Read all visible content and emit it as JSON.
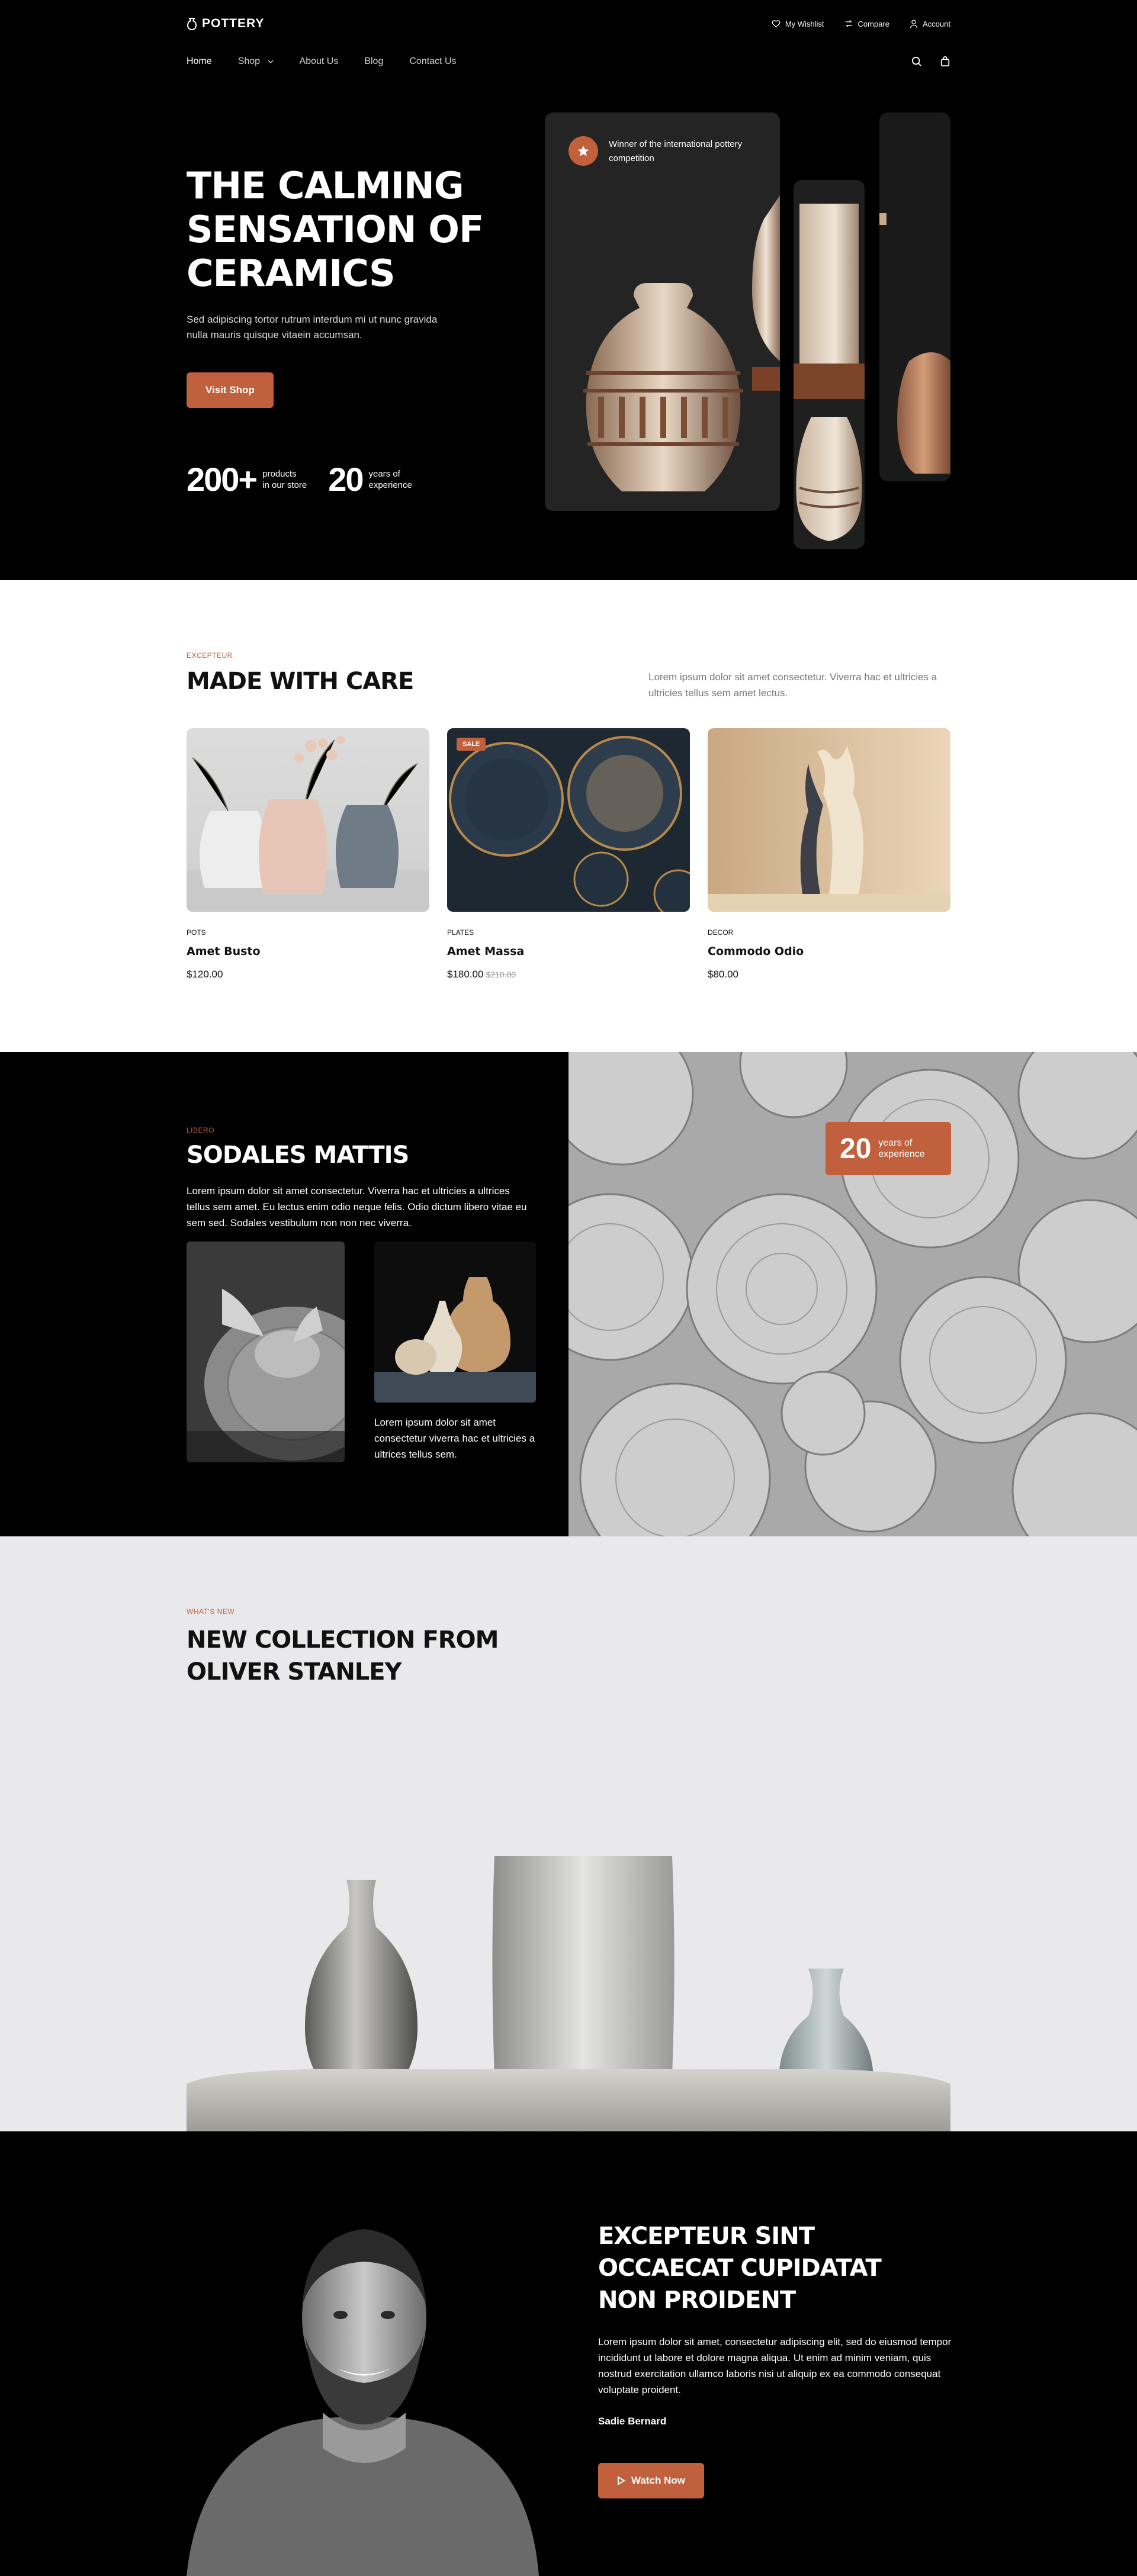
{
  "header": {
    "logo": "POTTERY",
    "utils": [
      {
        "label": "My Wishlist",
        "icon": "heart-icon"
      },
      {
        "label": "Compare",
        "icon": "compare-icon"
      },
      {
        "label": "Account",
        "icon": "user-icon"
      }
    ],
    "nav": [
      {
        "label": "Home",
        "active": true
      },
      {
        "label": "Shop",
        "active": false,
        "has_dropdown": true
      },
      {
        "label": "About Us",
        "active": false
      },
      {
        "label": "Blog",
        "active": false
      },
      {
        "label": "Contact Us",
        "active": false
      }
    ]
  },
  "hero": {
    "title_lines": [
      "THE CALMING",
      "SENSATION OF",
      "CERAMICS"
    ],
    "text": "Sed adipiscing tortor rutrum interdum mi ut nunc gravida nulla mauris quisque vitaein accumsan.",
    "button": "Visit Shop",
    "stats": [
      {
        "num": "200+",
        "label_1": "products",
        "label_2": "in our store"
      },
      {
        "num": "20",
        "label_1": "years of",
        "label_2": "experience"
      }
    ],
    "award": "Winner of the international pottery competition"
  },
  "care": {
    "eyebrow": "EXCEPTEUR",
    "title": "MADE WITH CARE",
    "desc": "Lorem ipsum dolor sit amet consectetur. Viverra hac et ultricies a ultricies tellus sem amet lectus.",
    "products": [
      {
        "category": "POTS",
        "name": "Amet Busto",
        "price": "$120.00",
        "old_price": "",
        "sale": ""
      },
      {
        "category": "PLATES",
        "name": "Amet Massa",
        "price": "$180.00",
        "old_price": "$210.00",
        "sale": "SALE"
      },
      {
        "category": "DECOR",
        "name": "Commodo Odio",
        "price": "$80.00",
        "old_price": "",
        "sale": ""
      }
    ]
  },
  "sodales": {
    "eyebrow": "LIBERO",
    "title": "SODALES MATTIS",
    "text": "Lorem ipsum dolor sit amet consectetur. Viverra hac et ultricies a ultrices tellus sem amet. Eu lectus enim odio neque felis. Odio dictum libero vitae eu sem sed. Sodales vestibulum non non nec viverra.",
    "caption": "Lorem ipsum dolor sit amet consectetur viverra hac et ultricies a ultrices tellus sem.",
    "badge": {
      "num": "20",
      "label_1": "years of",
      "label_2": "experience"
    }
  },
  "collection": {
    "eyebrow": "WHAT'S NEW",
    "title_lines": [
      "NEW COLLECTION FROM",
      "OLIVER STANLEY"
    ]
  },
  "testimonial": {
    "title_lines": [
      "EXCEPTEUR SINT",
      "OCCAECAT CUPIDATAT",
      "NON PROIDENT"
    ],
    "text": "Lorem ipsum dolor sit amet, consectetur adipiscing elit, sed do eiusmod tempor incididunt ut labore et dolore magna aliqua. Ut enim ad minim veniam, quis nostrud exercitation ullamco laboris nisi ut aliquip ex ea commodo consequat voluptate proident.",
    "name": "Sadie Bernard",
    "button": "Watch Now"
  }
}
